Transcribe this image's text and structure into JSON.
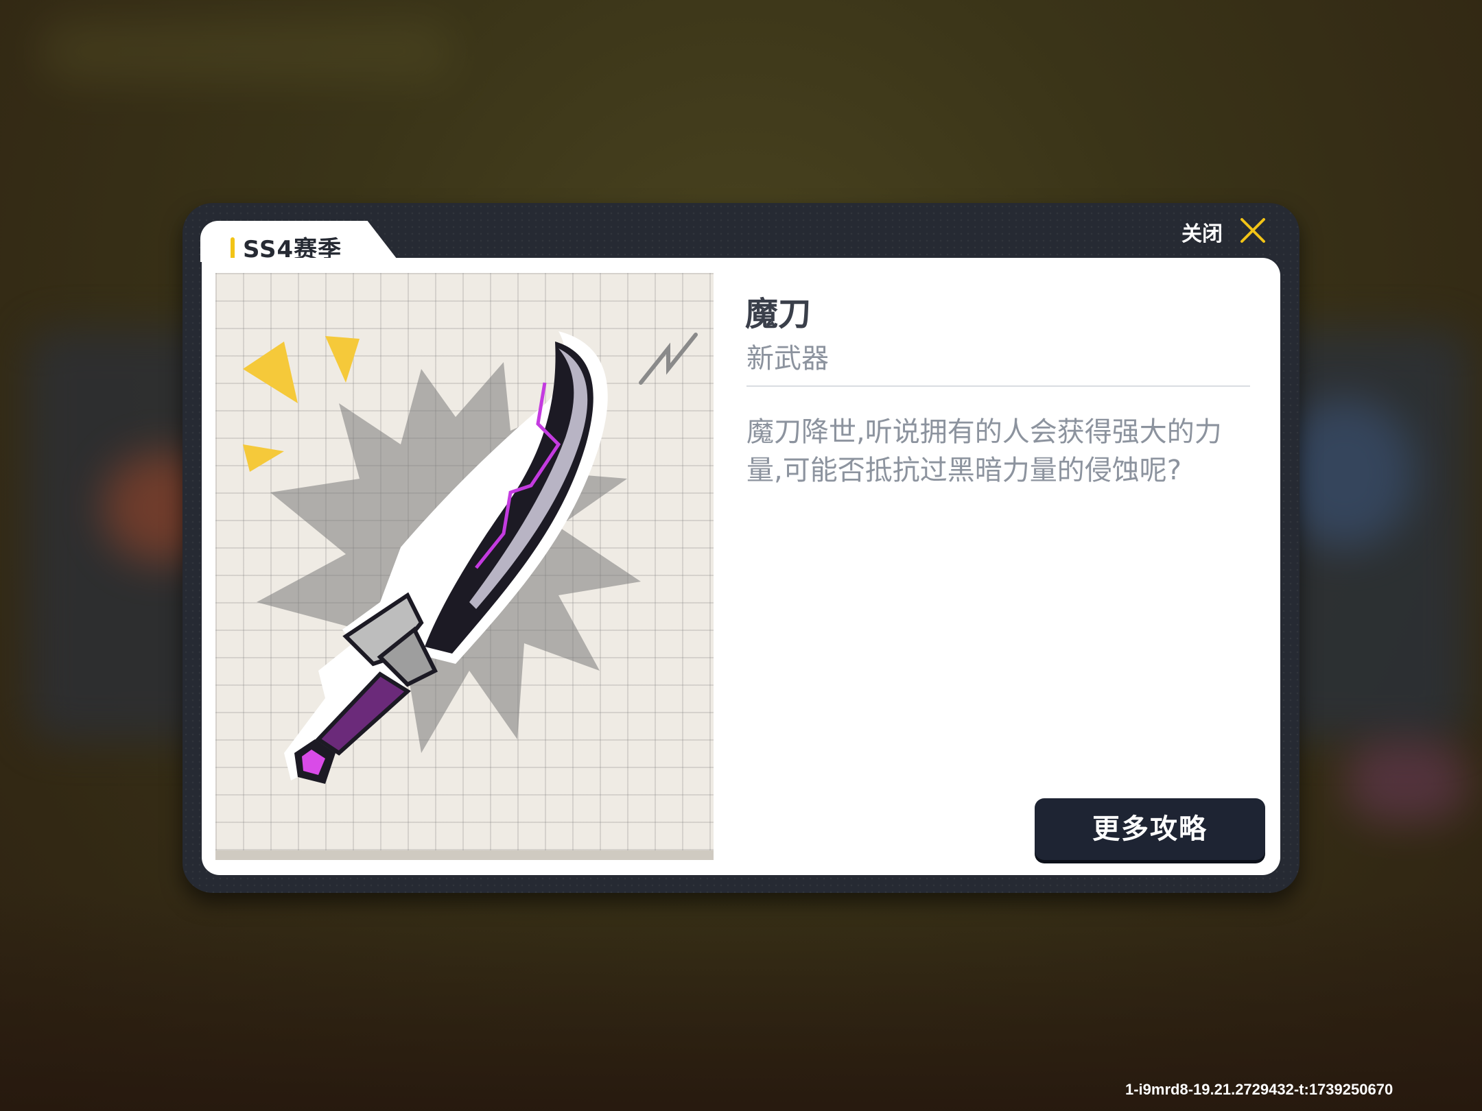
{
  "dialog": {
    "season_tab": "SS4赛季",
    "close_label": "关闭",
    "close_icon": "close-x-icon",
    "item_name": "魔刀",
    "item_type": "新武器",
    "description": "魔刀降世,听说拥有的人会获得强大的力量,可能否抵抗过黑暗力量的侵蚀呢?",
    "more_button": "更多攻略",
    "image_icon": "demon-blade-weapon-icon"
  },
  "footer": {
    "build_id": "1-i9mrd8-19.21.2729432-t:1739250670"
  },
  "colors": {
    "accent": "#f2c417",
    "dialog_frame": "#262a33",
    "button_bg": "#1e2433",
    "blade_glow": "#c43be0"
  }
}
